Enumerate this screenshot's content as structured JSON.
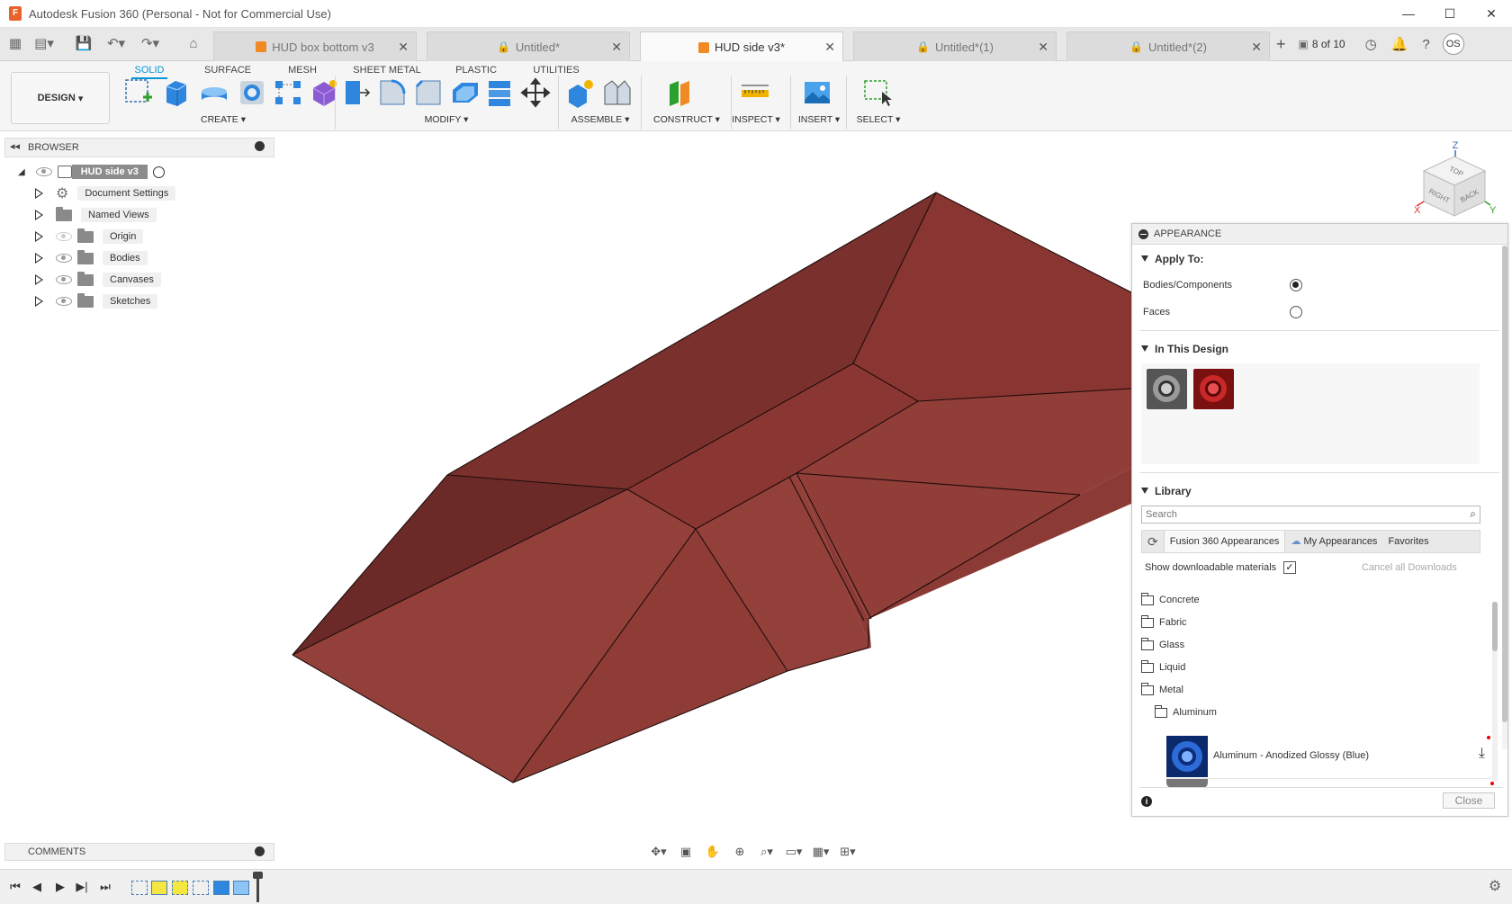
{
  "window": {
    "title": "Autodesk Fusion 360 (Personal - Not for Commercial Use)"
  },
  "tabs": [
    {
      "label": "HUD box bottom v3",
      "type": "cube",
      "active": false
    },
    {
      "label": "Untitled*",
      "type": "lock",
      "active": false
    },
    {
      "label": "HUD side v3*",
      "type": "cube",
      "active": true
    },
    {
      "label": "Untitled*(1)",
      "type": "lock",
      "active": false
    },
    {
      "label": "Untitled*(2)",
      "type": "lock",
      "active": false
    }
  ],
  "job_status": "8 of 10",
  "user_initials": "OS",
  "toolbar": {
    "workspace": "DESIGN",
    "workspace_tabs": [
      "SOLID",
      "SURFACE",
      "MESH",
      "SHEET METAL",
      "PLASTIC",
      "UTILITIES"
    ],
    "groups": [
      "CREATE",
      "MODIFY",
      "ASSEMBLE",
      "CONSTRUCT",
      "INSPECT",
      "INSERT",
      "SELECT"
    ]
  },
  "browser": {
    "title": "BROWSER",
    "root": "HUD side v3",
    "items": [
      "Document Settings",
      "Named Views",
      "Origin",
      "Bodies",
      "Canvases",
      "Sketches"
    ]
  },
  "viewcube": {
    "top": "TOP",
    "right": "RIGHT",
    "back": "BACK",
    "axis_z": "Z",
    "axis_x": "X",
    "axis_y": "Y"
  },
  "appearance": {
    "title": "APPEARANCE",
    "apply_to": {
      "header": "Apply To:",
      "options": [
        "Bodies/Components",
        "Faces"
      ],
      "selected": "Bodies/Components"
    },
    "in_this_design": {
      "header": "In This Design",
      "swatch_colors": [
        "#6f6f6f",
        "#b01e1e"
      ]
    },
    "library": {
      "header": "Library",
      "search_placeholder": "Search",
      "tabs": [
        "Fusion 360 Appearances",
        "My Appearances",
        "Favorites"
      ],
      "show_downloadable_label": "Show downloadable materials",
      "show_downloadable_checked": true,
      "cancel_downloads": "Cancel all Downloads",
      "folders": [
        "Concrete",
        "Fabric",
        "Glass",
        "Liquid",
        "Metal"
      ],
      "subfolder": "Aluminum",
      "material": "Aluminum - Anodized Glossy (Blue)"
    },
    "close_label": "Close"
  },
  "comments": {
    "title": "COMMENTS"
  },
  "colors": {
    "accent": "#0696d7",
    "model_face_light": "#93413b",
    "model_face_dark": "#6e2c29",
    "timeline_highlight": "#f5e642"
  }
}
